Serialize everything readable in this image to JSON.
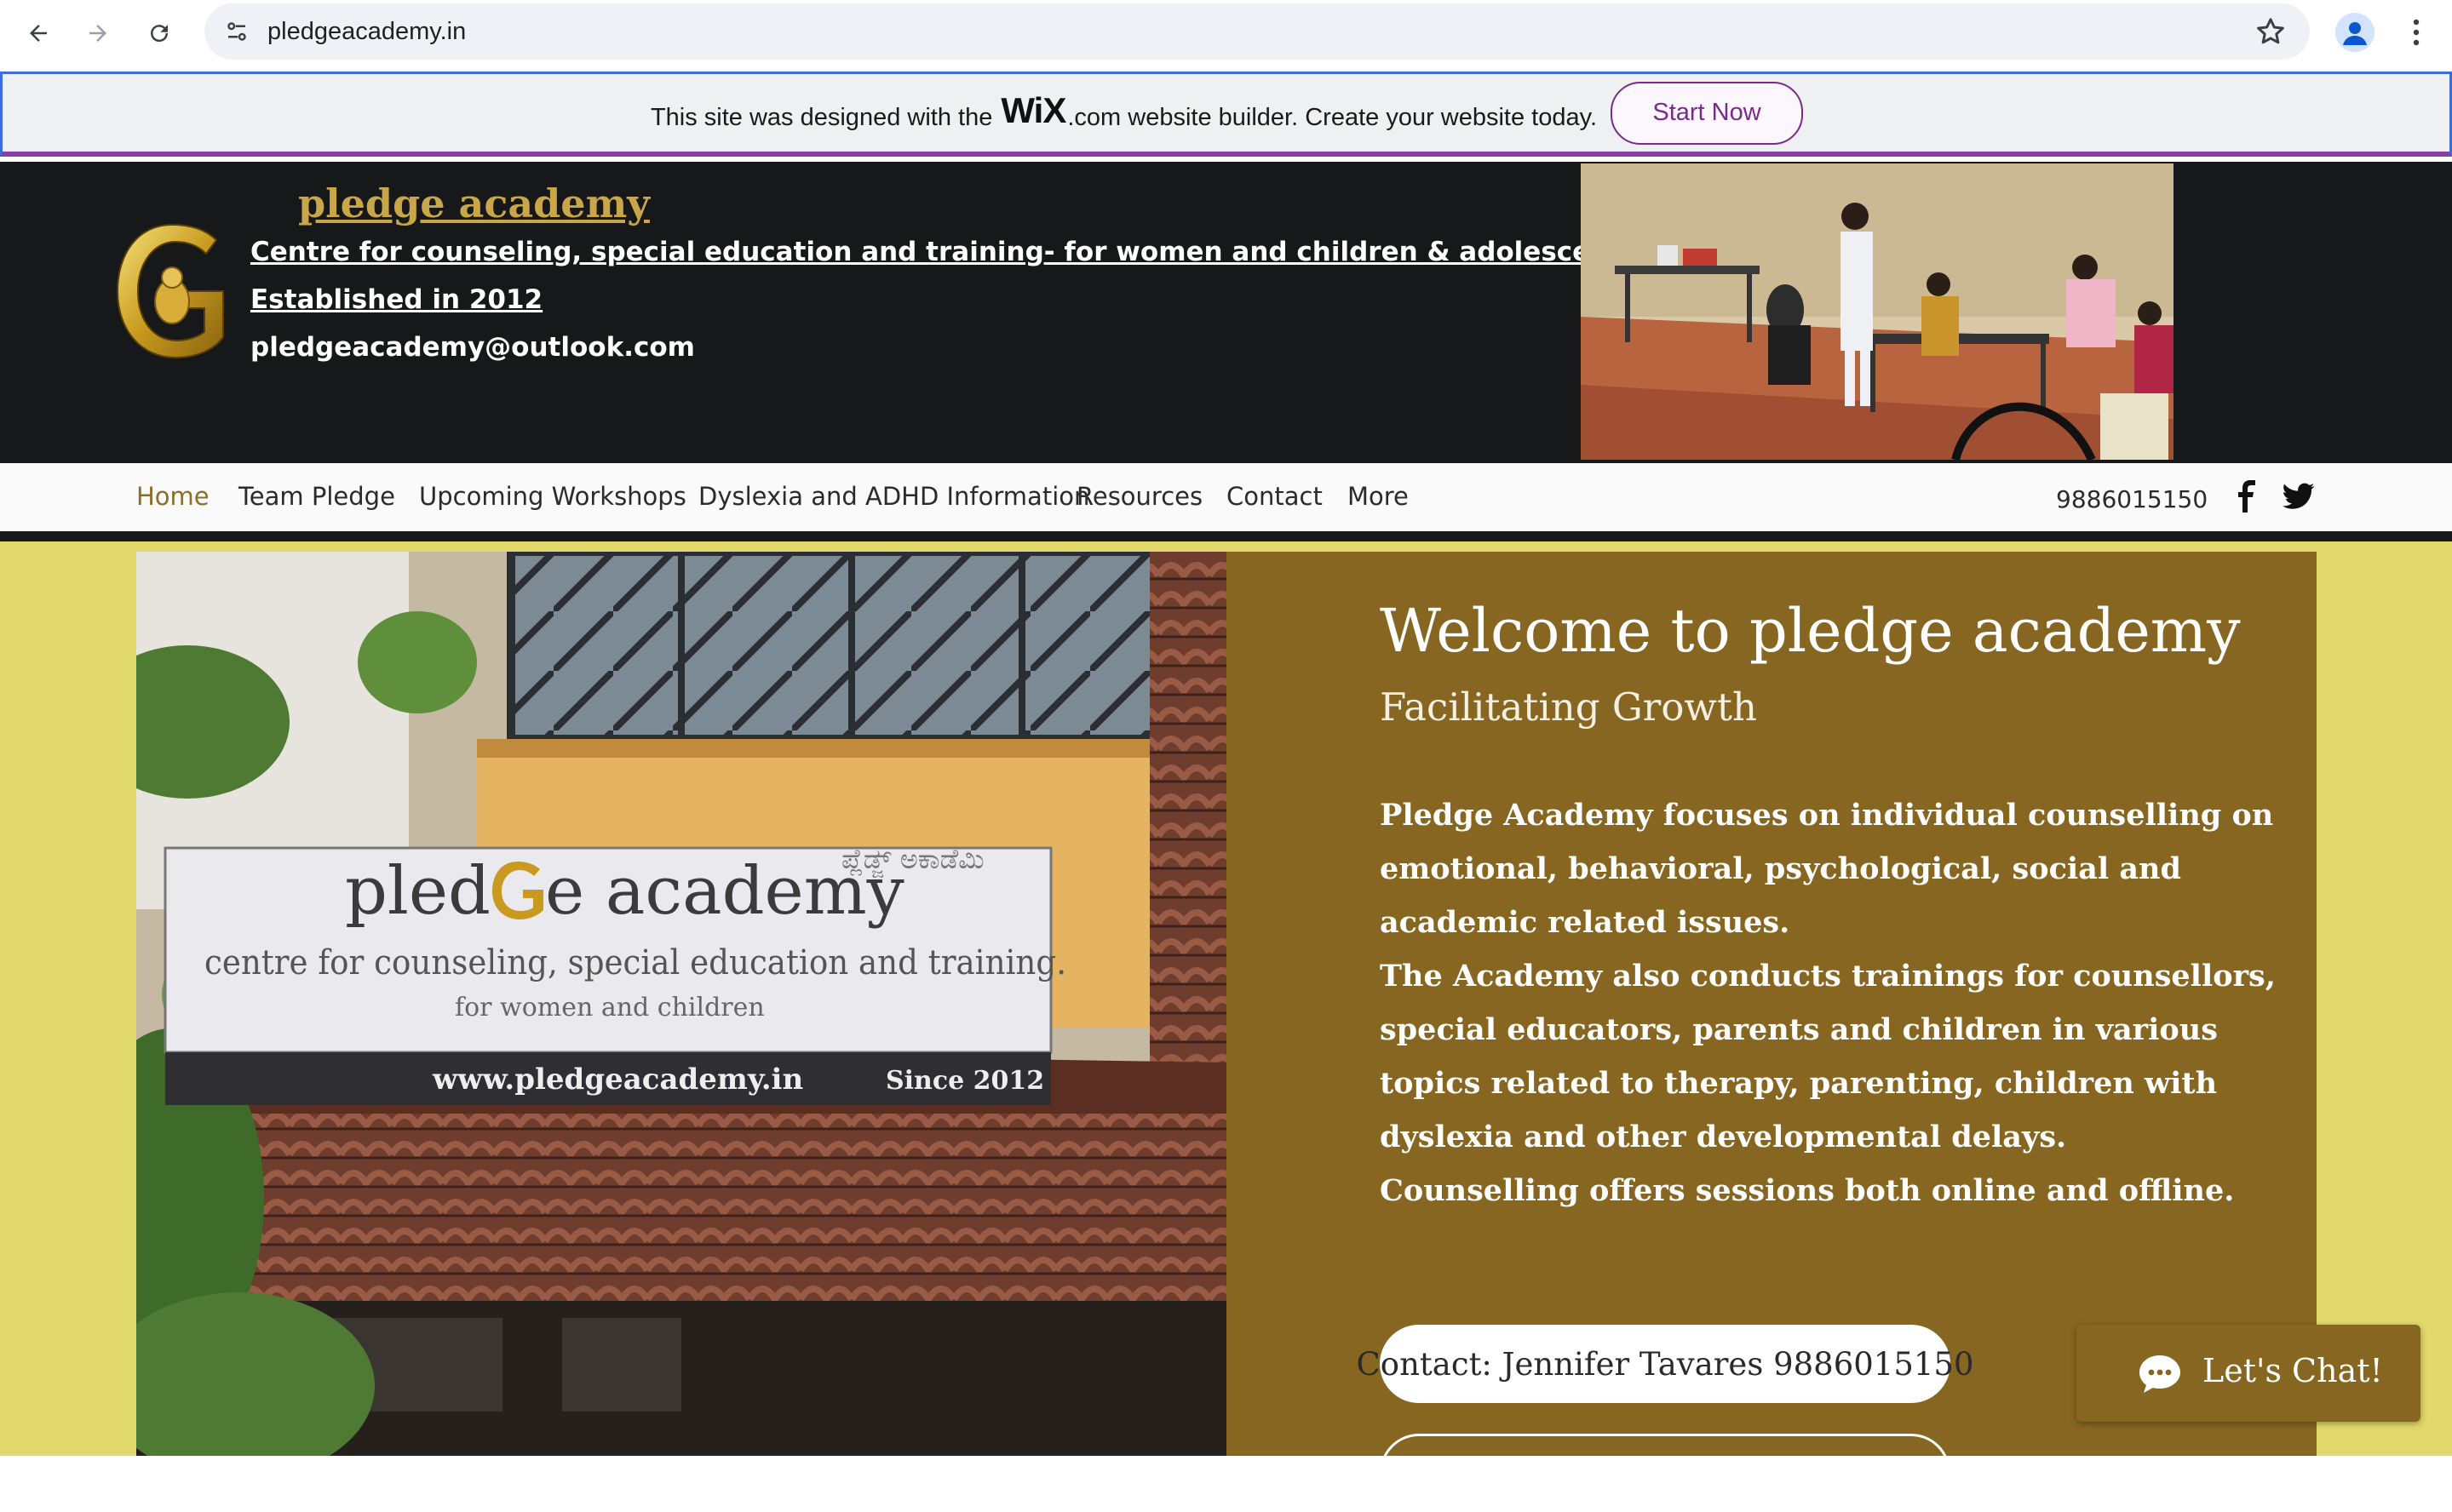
{
  "browser": {
    "url": "pledgeacademy.in",
    "icons": [
      "back-icon",
      "forward-icon",
      "reload-icon",
      "site-info-icon",
      "bookmark-star-icon",
      "profile-icon",
      "menu-kebab-icon"
    ]
  },
  "wix_banner": {
    "prefix": "This site was designed with the",
    "logo": "WiX",
    "suffix": ".com website builder. Create your website today.",
    "cta": "Start Now"
  },
  "header": {
    "brand": "pledge academy",
    "tagline": "Centre for counseling, special education and training- for women and children & adolescents",
    "established": "Established in 2012",
    "email": "pledgeacademy@outlook.com"
  },
  "nav": {
    "items": [
      {
        "label": "Home",
        "active": true
      },
      {
        "label": "Team Pledge"
      },
      {
        "label": "Upcoming Workshops"
      },
      {
        "label": "Dyslexia and ADHD Information"
      },
      {
        "label": "Resources"
      },
      {
        "label": "Contact"
      },
      {
        "label": "More"
      }
    ],
    "phone": "9886015150"
  },
  "hero": {
    "title": "Welcome to pledge academy",
    "subtitle": "Facilitating Growth",
    "body_lines": [
      "Pledge Academy focuses on individual counselling on",
      "emotional, behavioral, psychological, social and",
      "academic related issues.",
      "The Academy also conducts trainings for counsellors,",
      "special educators, parents and children in various",
      "topics related to therapy, parenting, children with",
      "dyslexia and other developmental delays.",
      "Counselling offers sessions both online and offline."
    ],
    "contact_button": "Contact: Jennifer Tavares 9886015150",
    "sign": {
      "name": "pled",
      "name_end": "e academy",
      "line1": "centre for counseling, special education and training.",
      "line2": "for women and children",
      "website": "www.pledgeacademy.in",
      "since": "Since 2012",
      "kannada": "ಪ್ಲೆಡ್ಜ್ ಅಕಾಡೆಮಿ"
    }
  },
  "chat": {
    "label": "Let's Chat!"
  },
  "colors": {
    "header_bg": "#17181a",
    "brand_gold": "#c9a648",
    "hero_bg": "#e1d96b",
    "panel_brown": "#876621",
    "wix_purple": "#7a2a8a"
  }
}
